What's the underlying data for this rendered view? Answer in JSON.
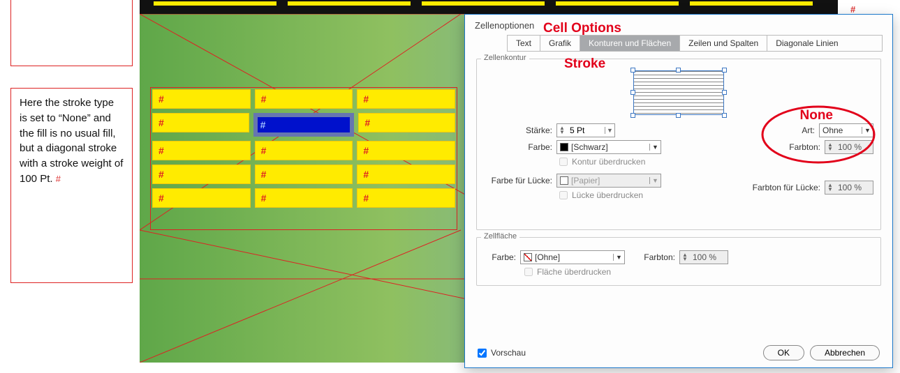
{
  "dialog": {
    "title": "Zellenoptionen",
    "annotation_title": "Cell Options",
    "tabs": [
      "Text",
      "Grafik",
      "Konturen und Flächen",
      "Zeilen und Spalten",
      "Diagonale Linien"
    ],
    "active_tab": 2,
    "group_stroke_label": "Zellenkontur",
    "group_fill_label": "Zellfläche",
    "stroke_label_weight": "Stärke:",
    "stroke_value_weight": "5 Pt",
    "stroke_label_color": "Farbe:",
    "stroke_color_name": "[Schwarz]",
    "overprint_stroke": "Kontur überdrucken",
    "gap_color_label": "Farbe für Lücke:",
    "gap_color_name": "[Papier]",
    "overprint_gap": "Lücke überdrucken",
    "type_label": "Art:",
    "type_value": "Ohne",
    "tint_label": "Farbton:",
    "tint_value": "100 %",
    "gap_tint_label": "Farbton für Lücke:",
    "gap_tint_value": "100 %",
    "fill_color_label": "Farbe:",
    "fill_color_name": "[Ohne]",
    "fill_tint_label": "Farbton:",
    "fill_tint_value": "100 %",
    "overprint_fill": "Fläche überdrucken",
    "preview_label": "Vorschau",
    "btn_ok": "OK",
    "btn_cancel": "Abbrechen"
  },
  "annotations": {
    "stroke": "Stroke",
    "none": "None"
  },
  "description": "Here the stroke type is set to “None” and the fill is no usual fill, but a diagonal stroke with a stroke weight of 100 Pt.",
  "desc_hash": "#",
  "table": {
    "rows": 5,
    "cols": 3,
    "selected": {
      "row": 1,
      "col": 1
    },
    "cell_text": "#"
  },
  "colors": {
    "yellow": "#ffeb00",
    "blue": "#0011cc",
    "red": "#e2001a"
  }
}
